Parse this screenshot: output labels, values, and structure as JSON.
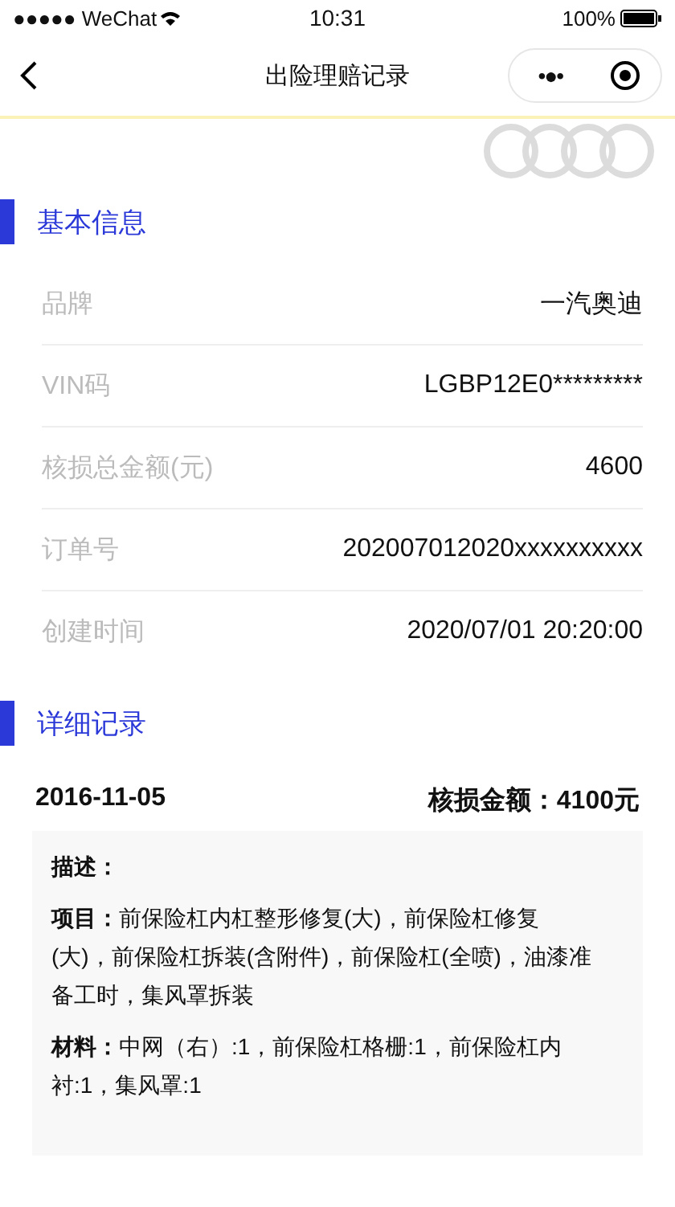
{
  "status_bar": {
    "carrier": "●●●●● WeChat",
    "time": "10:31",
    "battery": "100%"
  },
  "nav": {
    "title": "出险理赔记录",
    "more": "•●•"
  },
  "basic_section": {
    "title": "基本信息"
  },
  "basic_rows": [
    {
      "label": "品牌",
      "value": "一汽奥迪"
    },
    {
      "label": "VIN码",
      "value": "LGBP12E0*********"
    },
    {
      "label": "核损总金额(元)",
      "value": "4600"
    },
    {
      "label": "订单号",
      "value": "202007012020xxxxxxxxxx"
    },
    {
      "label": "创建时间",
      "value": "2020/07/01 20:20:00"
    }
  ],
  "detail_section": {
    "title": "详细记录"
  },
  "records": [
    {
      "date": "2016-11-05",
      "amount": "核损金额：4100元",
      "paragraphs": [
        "描述：",
        "**项目：**前保险杠内杠整形修复(大)，前保险杠修复(大)，前保险杠拆装(含附件)，前保险杠(全喷)，油漆准备工时，集风罩拆装",
        "**材料：**中网（右）:1，前保险杠格栅:1，前保险杠内衬:1，集风罩:1"
      ]
    }
  ]
}
